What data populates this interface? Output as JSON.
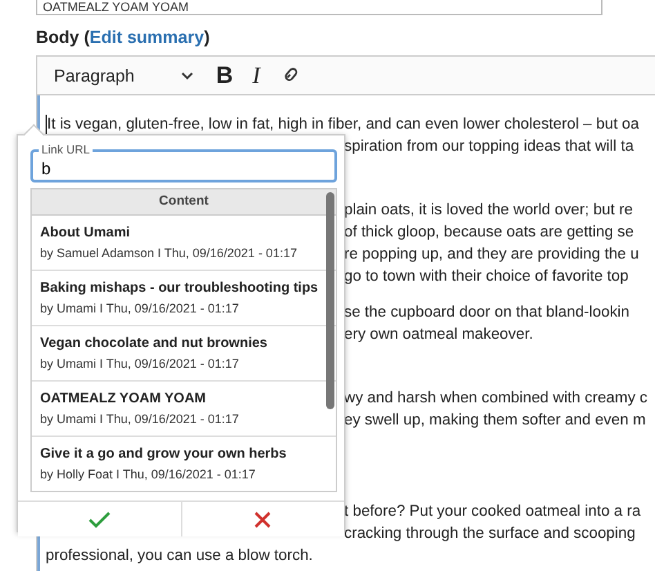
{
  "title_field": {
    "value": "OATMEALZ YOAM YOAM"
  },
  "body_label": {
    "text": "Body (",
    "link": "Edit summary",
    "after": ")"
  },
  "toolbar": {
    "format": "Paragraph",
    "buttons": [
      {
        "kind": "bold",
        "label": "B"
      },
      {
        "kind": "italic",
        "label": "I"
      },
      {
        "kind": "link"
      }
    ]
  },
  "editor": {
    "blocks": [
      {
        "kind": "paragraph",
        "lines": [
          {
            "kind": "full",
            "text": "It is vegan, gluten-free, low in fat, high in fiber, and can even lower cholesterol – but oa"
          },
          {
            "kind": "beside_popup",
            "text": "spiration from our topping ideas that will ta"
          }
        ]
      },
      {
        "kind": "hidden"
      },
      {
        "kind": "paragraph",
        "lines": [
          {
            "kind": "beside_popup",
            "text": "plain oats, it is loved the world over; but re"
          },
          {
            "kind": "beside_popup",
            "text": "of thick gloop, because oats are getting se"
          },
          {
            "kind": "beside_popup",
            "text": "re popping up, and they are providing the u"
          },
          {
            "kind": "beside_popup",
            "text": "go to town with their choice of favorite top"
          }
        ]
      },
      {
        "kind": "paragraph",
        "lines": [
          {
            "kind": "beside_popup",
            "text": "se the cupboard door on that bland-lookin"
          },
          {
            "kind": "beside_popup",
            "text": "ery own oatmeal makeover."
          }
        ]
      },
      {
        "kind": "hidden"
      },
      {
        "kind": "paragraph",
        "lines": [
          {
            "kind": "beside_popup",
            "text": "wy and harsh when combined with creamy c"
          },
          {
            "kind": "beside_popup",
            "text": "ey swell up, making them softer and even m"
          }
        ]
      },
      {
        "kind": "hidden"
      },
      {
        "kind": "hidden"
      },
      {
        "kind": "paragraph",
        "lines": [
          {
            "kind": "beside_popup",
            "text": "t before? Put your cooked oatmeal into a ra"
          },
          {
            "kind": "beside_popup",
            "text": "cracking through the surface and scooping"
          },
          {
            "kind": "full",
            "text": "professional, you can use a blow torch."
          }
        ]
      }
    ]
  },
  "link_popup": {
    "label": "Link URL",
    "value": "b",
    "list_header": "Content",
    "results": [
      {
        "title": "About Umami",
        "meta": "by Samuel Adamson I Thu, 09/16/2021 - 01:17"
      },
      {
        "title": "Baking mishaps - our troubleshooting tips",
        "meta": "by Umami I Thu, 09/16/2021 - 01:17"
      },
      {
        "title": "Vegan chocolate and nut brownies",
        "meta": "by Umami I Thu, 09/16/2021 - 01:17"
      },
      {
        "title": "OATMEALZ YOAM YOAM",
        "meta": "by Umami I Thu, 09/16/2021 - 01:17"
      },
      {
        "title": "Give it a go and grow your own herbs",
        "meta": "by Holly Foat I Thu, 09/16/2021 - 01:17"
      }
    ]
  }
}
